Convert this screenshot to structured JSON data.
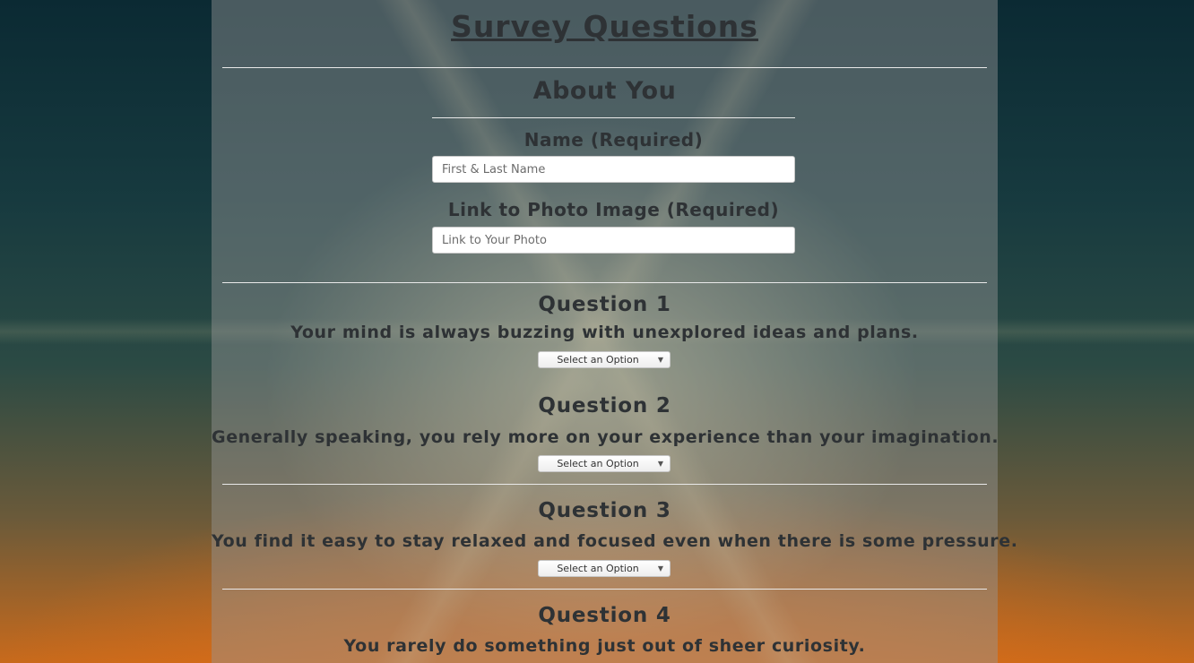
{
  "page": {
    "title": "Survey Questions"
  },
  "about": {
    "heading": "About You",
    "name_label": "Name (Required)",
    "name_placeholder": "First & Last Name",
    "photo_label": "Link to Photo Image (Required)",
    "photo_placeholder": "Link to Your Photo"
  },
  "questions": [
    {
      "title": "Question 1",
      "text": "Your mind is always buzzing with unexplored ideas and plans.",
      "select": "Select an Option"
    },
    {
      "title": "Question 2",
      "text": "Generally speaking, you rely more on your experience than your imagination.",
      "select": "Select an Option"
    },
    {
      "title": "Question 3",
      "text": "You find it easy to stay relaxed and focused even when there is some pressure.",
      "select": "Select an Option"
    },
    {
      "title": "Question 4",
      "text": "You rarely do something just out of sheer curiosity."
    }
  ],
  "icons": {
    "dropdown": "chevron-down-icon"
  },
  "colors": {
    "text": "#2e3235",
    "divider": "#e9e9e9"
  }
}
